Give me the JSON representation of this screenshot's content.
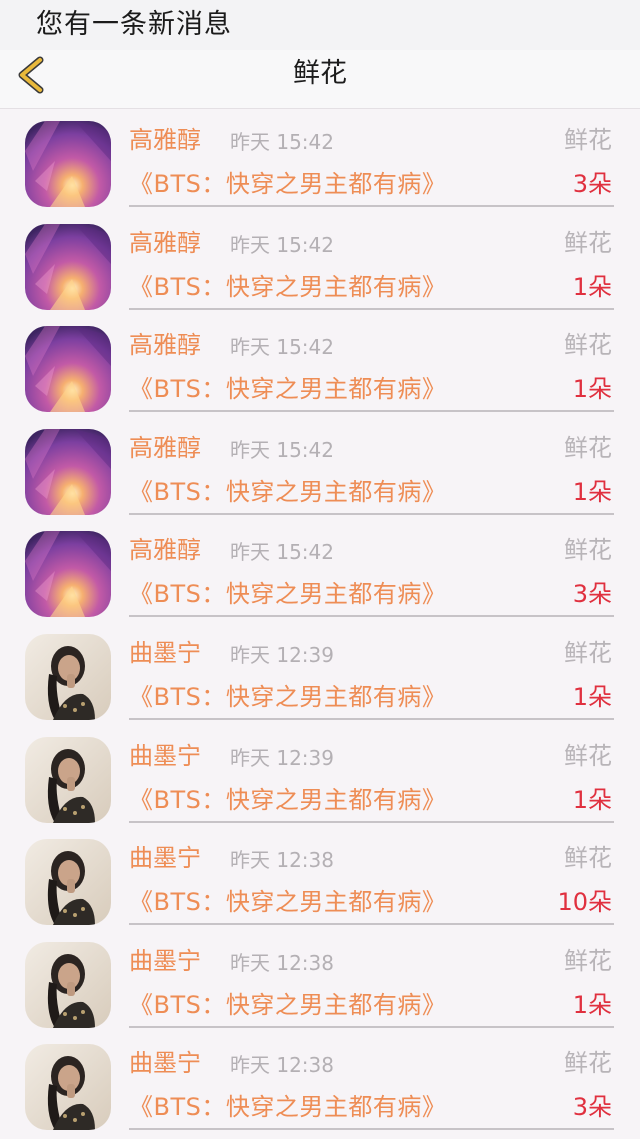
{
  "banner": {
    "text": "您有一条新消息"
  },
  "nav": {
    "title": "鲜花",
    "back_icon": "chevron-left-icon"
  },
  "rows": [
    {
      "name": "高雅醇",
      "time": "昨天 15:42",
      "tag": "鲜花",
      "book": "《BTS：快穿之男主都有病》",
      "count": "3朵",
      "avatar": "purple"
    },
    {
      "name": "高雅醇",
      "time": "昨天 15:42",
      "tag": "鲜花",
      "book": "《BTS：快穿之男主都有病》",
      "count": "1朵",
      "avatar": "purple"
    },
    {
      "name": "高雅醇",
      "time": "昨天 15:42",
      "tag": "鲜花",
      "book": "《BTS：快穿之男主都有病》",
      "count": "1朵",
      "avatar": "purple"
    },
    {
      "name": "高雅醇",
      "time": "昨天 15:42",
      "tag": "鲜花",
      "book": "《BTS：快穿之男主都有病》",
      "count": "1朵",
      "avatar": "purple"
    },
    {
      "name": "高雅醇",
      "time": "昨天 15:42",
      "tag": "鲜花",
      "book": "《BTS：快穿之男主都有病》",
      "count": "3朵",
      "avatar": "purple"
    },
    {
      "name": "曲墨宁",
      "time": "昨天 12:39",
      "tag": "鲜花",
      "book": "《BTS：快穿之男主都有病》",
      "count": "1朵",
      "avatar": "photo"
    },
    {
      "name": "曲墨宁",
      "time": "昨天 12:39",
      "tag": "鲜花",
      "book": "《BTS：快穿之男主都有病》",
      "count": "1朵",
      "avatar": "photo"
    },
    {
      "name": "曲墨宁",
      "time": "昨天 12:38",
      "tag": "鲜花",
      "book": "《BTS：快穿之男主都有病》",
      "count": "10朵",
      "avatar": "photo"
    },
    {
      "name": "曲墨宁",
      "time": "昨天 12:38",
      "tag": "鲜花",
      "book": "《BTS：快穿之男主都有病》",
      "count": "1朵",
      "avatar": "photo"
    },
    {
      "name": "曲墨宁",
      "time": "昨天 12:38",
      "tag": "鲜花",
      "book": "《BTS：快穿之男主都有病》",
      "count": "3朵",
      "avatar": "photo"
    }
  ],
  "colors": {
    "accent_orange": "#ee8d55",
    "count_red": "#e0303f",
    "muted_gray": "#b4b0b4",
    "back_yellow": "#e9b93b"
  }
}
